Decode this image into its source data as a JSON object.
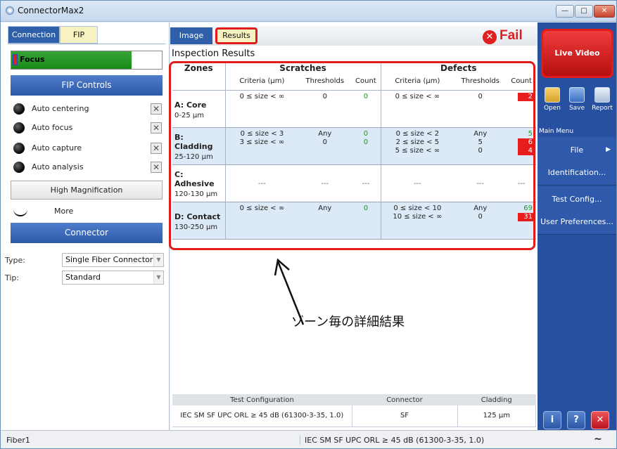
{
  "window": {
    "title": "ConnectorMax2"
  },
  "left_panel": {
    "tabs": [
      {
        "label": "Connection"
      },
      {
        "label": "FIP"
      }
    ],
    "focus": {
      "label": "Focus",
      "level": 0.8
    },
    "fip_controls": {
      "header": "FIP Controls",
      "items": [
        {
          "label": "Auto centering"
        },
        {
          "label": "Auto focus"
        },
        {
          "label": "Auto capture"
        },
        {
          "label": "Auto analysis"
        }
      ]
    },
    "high_magnification": "High Magnification",
    "more": "More",
    "connector": {
      "header": "Connector",
      "type_label": "Type:",
      "type_value": "Single Fiber Connector",
      "tip_label": "Tip:",
      "tip_value": "Standard"
    }
  },
  "main": {
    "tabs": [
      {
        "label": "Image"
      },
      {
        "label": "Results"
      }
    ],
    "result": "Fail",
    "title": "Inspection Results",
    "table": {
      "col_zones": "Zones",
      "col_scratches": "Scratches",
      "col_defects": "Defects",
      "sub_criteria": "Criteria (μm)",
      "sub_thresholds": "Thresholds",
      "sub_count": "Count",
      "rows": [
        {
          "name": "A: Core",
          "range": "0-25 μm",
          "s_criteria": "0 ≤ size < ∞",
          "s_thresholds": "0",
          "s_count": "0",
          "d_criteria": "0 ≤ size < ∞",
          "d_thresholds": "0",
          "d_count": "2"
        },
        {
          "name": "B: Cladding",
          "range": "25-120 μm",
          "s_criteria": "0 ≤ size < 3",
          "s_criteria2": "3 ≤ size < ∞",
          "s_thresholds": "Any",
          "s_thresholds2": "0",
          "s_count": "0",
          "s_count2": "0",
          "d_criteria": "0 ≤ size < 2",
          "d_criteria2": "2 ≤ size < 5",
          "d_criteria3": "5 ≤ size < ∞",
          "d_thresholds": "Any",
          "d_thresholds2": "5",
          "d_thresholds3": "0",
          "d_count": "5",
          "d_count2": "6",
          "d_count3": "4"
        },
        {
          "name": "C: Adhesive",
          "range": "120-130 μm",
          "empty": "---"
        },
        {
          "name": "D: Contact",
          "range": "130-250 μm",
          "s_criteria": "0 ≤ size < ∞",
          "s_thresholds": "Any",
          "s_count": "0",
          "d_criteria": "0 ≤ size < 10",
          "d_criteria2": "10 ≤ size < ∞",
          "d_thresholds": "Any",
          "d_thresholds2": "0",
          "d_count": "69",
          "d_count2": "31"
        }
      ]
    },
    "annotation": "ゾーン毎の詳細結果",
    "config": {
      "h_test": "Test Configuration",
      "h_connector": "Connector",
      "h_cladding": "Cladding",
      "v_test": "IEC SM SF UPC ORL ≥ 45 dB (61300-3-35, 1.0)",
      "v_connector": "SF",
      "v_cladding": "125 μm"
    }
  },
  "right_panel": {
    "live_video": "Live Video",
    "toolbar": [
      {
        "label": "Open"
      },
      {
        "label": "Save"
      },
      {
        "label": "Report"
      }
    ],
    "main_menu_label": "Main Menu",
    "menu": [
      {
        "label": "File"
      },
      {
        "label": "Identification..."
      },
      {
        "label": "Test Config..."
      },
      {
        "label": "User Preferences..."
      }
    ]
  },
  "status_bar": {
    "left": "Fiber1",
    "center": "IEC SM SF UPC ORL ≥ 45 dB (61300-3-35, 1.0)"
  },
  "colors": {
    "accent_blue": "#2f5fa8",
    "fail_red": "#e02020",
    "pass_green": "#1a9a1a",
    "highlight_red": "#e21b1b"
  }
}
